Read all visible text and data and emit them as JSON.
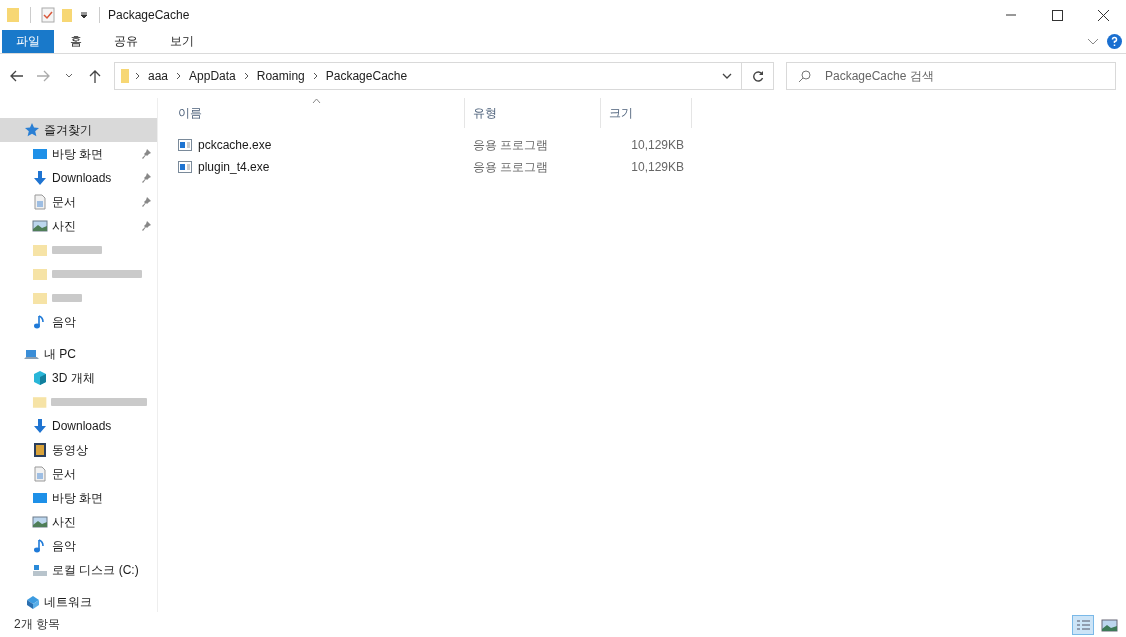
{
  "window": {
    "title": "PackageCache"
  },
  "ribbon_tabs": [
    {
      "label": "파일",
      "selected": true
    },
    {
      "label": "홈",
      "selected": false
    },
    {
      "label": "공유",
      "selected": false
    },
    {
      "label": "보기",
      "selected": false
    }
  ],
  "address_bar": {
    "segments": [
      "aaa",
      "AppData",
      "Roaming",
      "PackageCache"
    ]
  },
  "search": {
    "placeholder": "PackageCache 검색"
  },
  "sidebar": {
    "items": [
      {
        "label": "즐겨찾기",
        "kind": "star",
        "selected": true,
        "children": [
          {
            "label": "바탕 화면",
            "kind": "desktop",
            "pinned": true
          },
          {
            "label": "Downloads",
            "kind": "download",
            "pinned": true
          },
          {
            "label": "문서",
            "kind": "document",
            "pinned": true
          },
          {
            "label": "사진",
            "kind": "photo",
            "pinned": true
          },
          {
            "kind": "redacted",
            "pinned": false
          },
          {
            "kind": "redacted",
            "pinned": false
          },
          {
            "kind": "redacted",
            "pinned": false
          },
          {
            "label": "음악",
            "kind": "music",
            "pinned": false
          }
        ]
      },
      {
        "label": "내 PC",
        "kind": "pc",
        "selected": false,
        "children": [
          {
            "label": "3D 개체",
            "kind": "cube",
            "pinned": false
          },
          {
            "kind": "redacted",
            "pinned": false
          },
          {
            "label": "Downloads",
            "kind": "download",
            "pinned": false
          },
          {
            "label": "동영상",
            "kind": "video",
            "pinned": false
          },
          {
            "label": "문서",
            "kind": "document",
            "pinned": false
          },
          {
            "label": "바탕 화면",
            "kind": "desktop",
            "pinned": false
          },
          {
            "label": "사진",
            "kind": "photo",
            "pinned": false
          },
          {
            "label": "음악",
            "kind": "music",
            "pinned": false
          },
          {
            "label": "로컬 디스크 (C:)",
            "kind": "drive",
            "pinned": false
          }
        ]
      },
      {
        "label": "네트워크",
        "kind": "network",
        "selected": false
      }
    ]
  },
  "table": {
    "columns": [
      "이름",
      "유형",
      "크기"
    ],
    "rows": [
      {
        "name": "pckcache.exe",
        "type": "응용 프로그램",
        "size": "10,129KB"
      },
      {
        "name": "plugin_t4.exe",
        "type": "응용 프로그램",
        "size": "10,129KB"
      }
    ]
  },
  "status_bar": {
    "text": "2개 항목",
    "views": [
      {
        "kind": "details",
        "selected": true
      },
      {
        "kind": "thumbs",
        "selected": false
      }
    ]
  }
}
